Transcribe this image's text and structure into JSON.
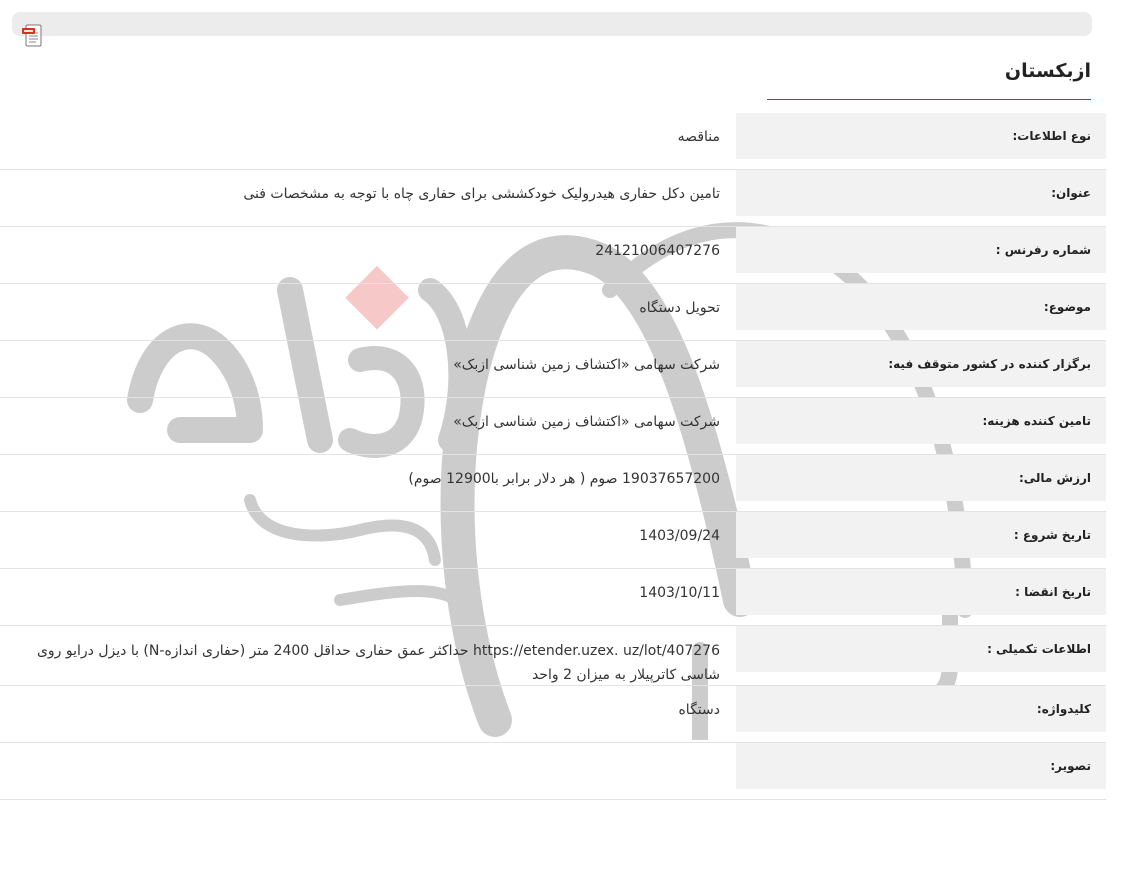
{
  "toolbar": {
    "pdf_icon": "pdf-file-icon"
  },
  "header": {
    "title": "ازبکستان"
  },
  "details": [
    {
      "label": "نوع اطلاعات:",
      "value": "مناقصه"
    },
    {
      "label": "عنوان:",
      "value": "تامین دکل حفاری هیدرولیک خودکششی برای حفاری چاه با توجه به مشخصات فنی"
    },
    {
      "label": "شماره رفرنس :",
      "value": "24121006407276"
    },
    {
      "label": "موضوع:",
      "value": "تحویل دستگاه"
    },
    {
      "label": "برگزار کننده در کشور متوقف فیه:",
      "value": "شرکت سهامی «اکتشاف زمین شناسی ازبک»"
    },
    {
      "label": "تامین کننده هزینه:",
      "value": "شرکت سهامی «اکتشاف زمین شناسی ازبک»"
    },
    {
      "label": "ارزش مالی:",
      "value": "19037657200 صوم ( هر دلار برابر با12900 صوم)"
    },
    {
      "label": "تاریخ شروع :",
      "value": "1403/09/24"
    },
    {
      "label": "تاریخ انقضا :",
      "value": "1403/10/11"
    },
    {
      "label": "اطلاعات تکمیلی :",
      "value": "https://etender.uzex. uz/lot/407276 حداکثر عمق حفاری حداقل 2400 متر (حفاری اندازه-N) با دیزل درایو روی شاسی کاترپیلار به میزان 2 واحد"
    },
    {
      "label": "کلیدواژه:",
      "value": "دستگاه"
    },
    {
      "label": "تصویر:",
      "value": ""
    }
  ]
}
